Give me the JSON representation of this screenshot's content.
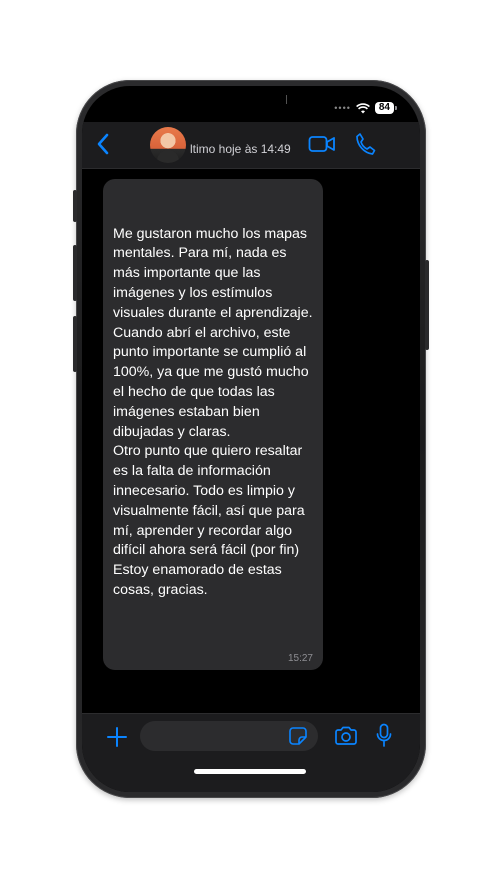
{
  "status_bar": {
    "battery": "84"
  },
  "header": {
    "last_seen": "ltimo hoje às 14:49"
  },
  "message": {
    "text": "Me gustaron mucho los mapas mentales. Para mí, nada es más importante que las imágenes y los estímulos visuales durante el aprendizaje.\nCuando abrí el archivo, este punto importante se cumplió al 100%, ya que me gustó mucho el hecho de que todas las imágenes estaban bien dibujadas y claras.\nOtro punto que quiero resaltar es la falta de información\ninnecesario. Todo es limpio y visualmente fácil, así que para mí, aprender y recordar algo difícil ahora será fácil (por fin)\nEstoy enamorado de estas cosas, gracias.",
    "time": "15:27"
  },
  "input": {
    "value": ""
  },
  "colors": {
    "accent": "#0a84ff",
    "bubble": "#2c2c2e",
    "header": "#1c1c1e"
  },
  "icons": [
    "back-icon",
    "video-icon",
    "phone-icon",
    "plus-icon",
    "sticker-icon",
    "camera-icon",
    "microphone-icon",
    "wifi-icon"
  ]
}
